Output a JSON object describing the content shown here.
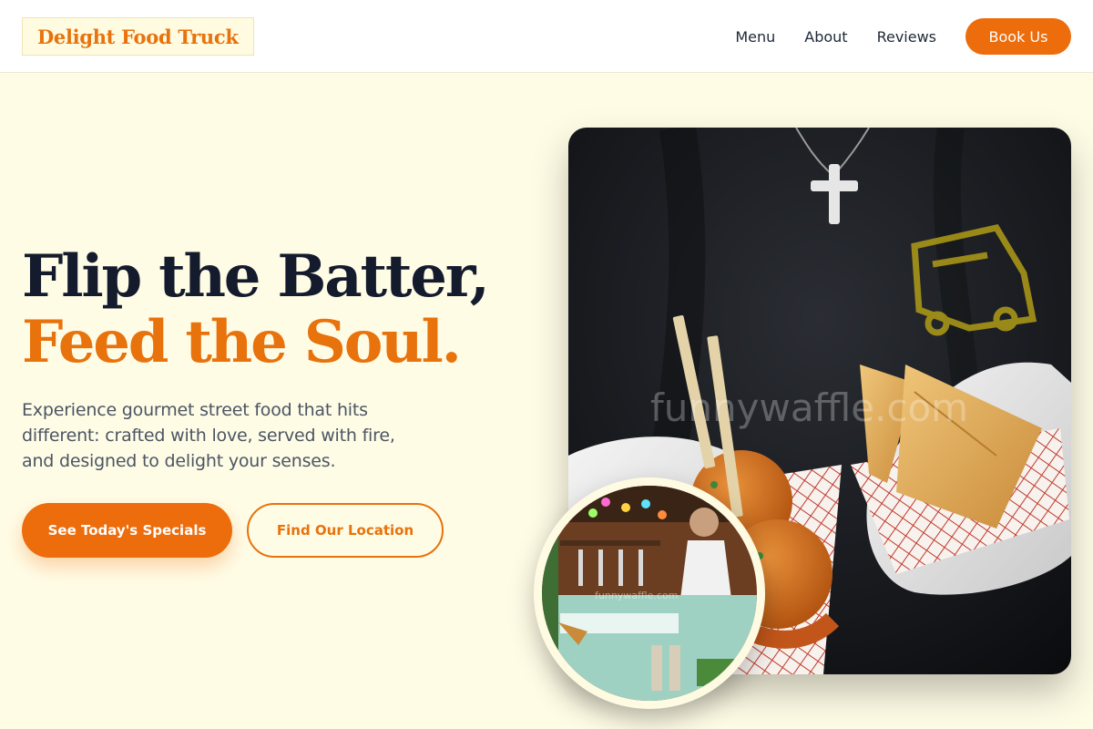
{
  "header": {
    "logo": "Delight Food Truck",
    "nav": [
      "Menu",
      "About",
      "Reviews"
    ],
    "cta": "Book Us"
  },
  "hero": {
    "headline_line1": "Flip the Batter,",
    "headline_line2": "Feed the Soul.",
    "description": "Experience gourmet street food that hits different: crafted with love, served with fire, and designed to delight your senses.",
    "primary_button": "See Today's Specials",
    "secondary_button": "Find Our Location"
  },
  "images": {
    "watermark": "funnywaffle.com",
    "inset_watermark": "funnywaffle.com"
  },
  "colors": {
    "accent": "#ed6c0b",
    "background": "#fffce6",
    "heading": "#141b2d"
  }
}
